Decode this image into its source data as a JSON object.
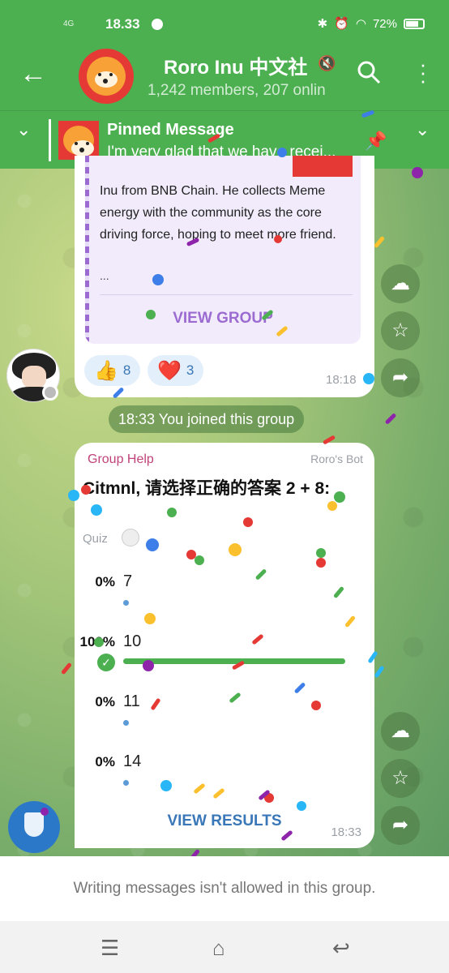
{
  "status_bar": {
    "signal": "4G",
    "time": "18.33",
    "battery": "72%"
  },
  "header": {
    "title": "Roro Inu 中文社",
    "subtitle": "1,242 members, 207 onlin"
  },
  "pinned": {
    "title": "Pinned Message",
    "text": "I'm very glad that we have recei..."
  },
  "message1": {
    "quote_text": "Inu from BNB Chain. He collects Meme energy with the community as the core driving force, hoping to meet more friend.",
    "ellipsis": "...",
    "view_group_label": "VIEW GROUP",
    "reactions": [
      {
        "emoji": "👍",
        "count": "8"
      },
      {
        "emoji": "❤️",
        "count": "3"
      }
    ],
    "time": "18:18"
  },
  "service_message": "18:33 You joined this group",
  "poll": {
    "sender": "Group Help",
    "via": "Roro's Bot",
    "question": "Citmnl, 请选择正确的答案 2 + 8:",
    "type_label": "Quiz",
    "options": [
      {
        "percent": "0%",
        "value": "7",
        "fraction": 0
      },
      {
        "percent": "100%",
        "value": "10",
        "fraction": 1.0,
        "correct": true
      },
      {
        "percent": "0%",
        "value": "11",
        "fraction": 0
      },
      {
        "percent": "0%",
        "value": "14",
        "fraction": 0
      }
    ],
    "view_results_label": "VIEW RESULTS",
    "time": "18:33"
  },
  "composer_notice": "Writing messages isn't allowed in this group.",
  "icons": {
    "back": "back-arrow-icon",
    "mute": "muted-speaker-icon",
    "search": "search-icon",
    "menu": "more-vertical-icon",
    "pin_list": "pin-list-icon",
    "cloud": "cloud-icon",
    "star": "star-icon",
    "share": "share-icon",
    "shield": "shield-icon"
  },
  "colors": {
    "header": "#4caf50",
    "poll_bar": "#4caf50",
    "link": "#3a77b8",
    "sender": "#c0437a",
    "view_group": "#9c6bd1"
  }
}
